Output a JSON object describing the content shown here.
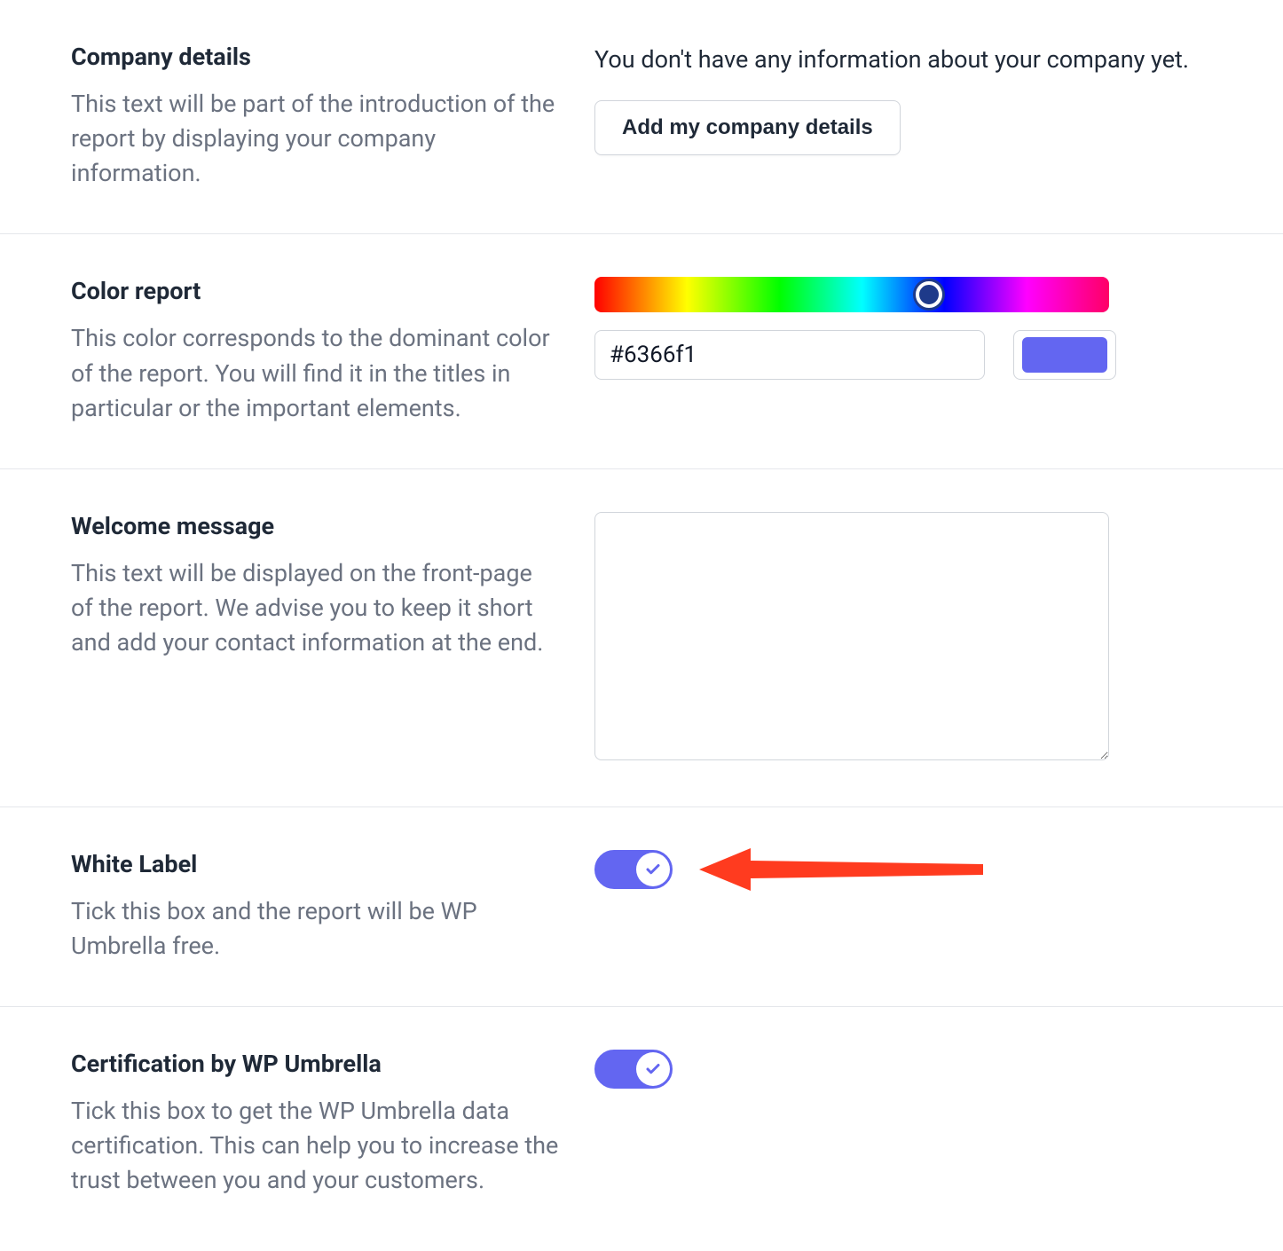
{
  "companyDetails": {
    "title": "Company details",
    "desc": "This text will be part of the introduction of the report by displaying your company information.",
    "info": "You don't have any information about your company yet.",
    "buttonLabel": "Add my company details"
  },
  "colorReport": {
    "title": "Color report",
    "desc": "This color corresponds to the dominant color of the report. You will find it in the titles in particular or the important elements.",
    "value": "#6366f1"
  },
  "welcome": {
    "title": "Welcome message",
    "desc": "This text will be displayed on the front-page of the report. We advise you to keep it short and add your contact information at the end.",
    "value": ""
  },
  "whiteLabel": {
    "title": "White Label",
    "desc": "Tick this box and the report will be WP Umbrella free.",
    "enabled": true
  },
  "certification": {
    "title": "Certification by WP Umbrella",
    "desc": "Tick this box to get the WP Umbrella data certification. This can help you to increase the trust between you and your customers.",
    "enabled": true
  },
  "colors": {
    "accent": "#6366f1",
    "arrow": "#ff3b1f"
  }
}
